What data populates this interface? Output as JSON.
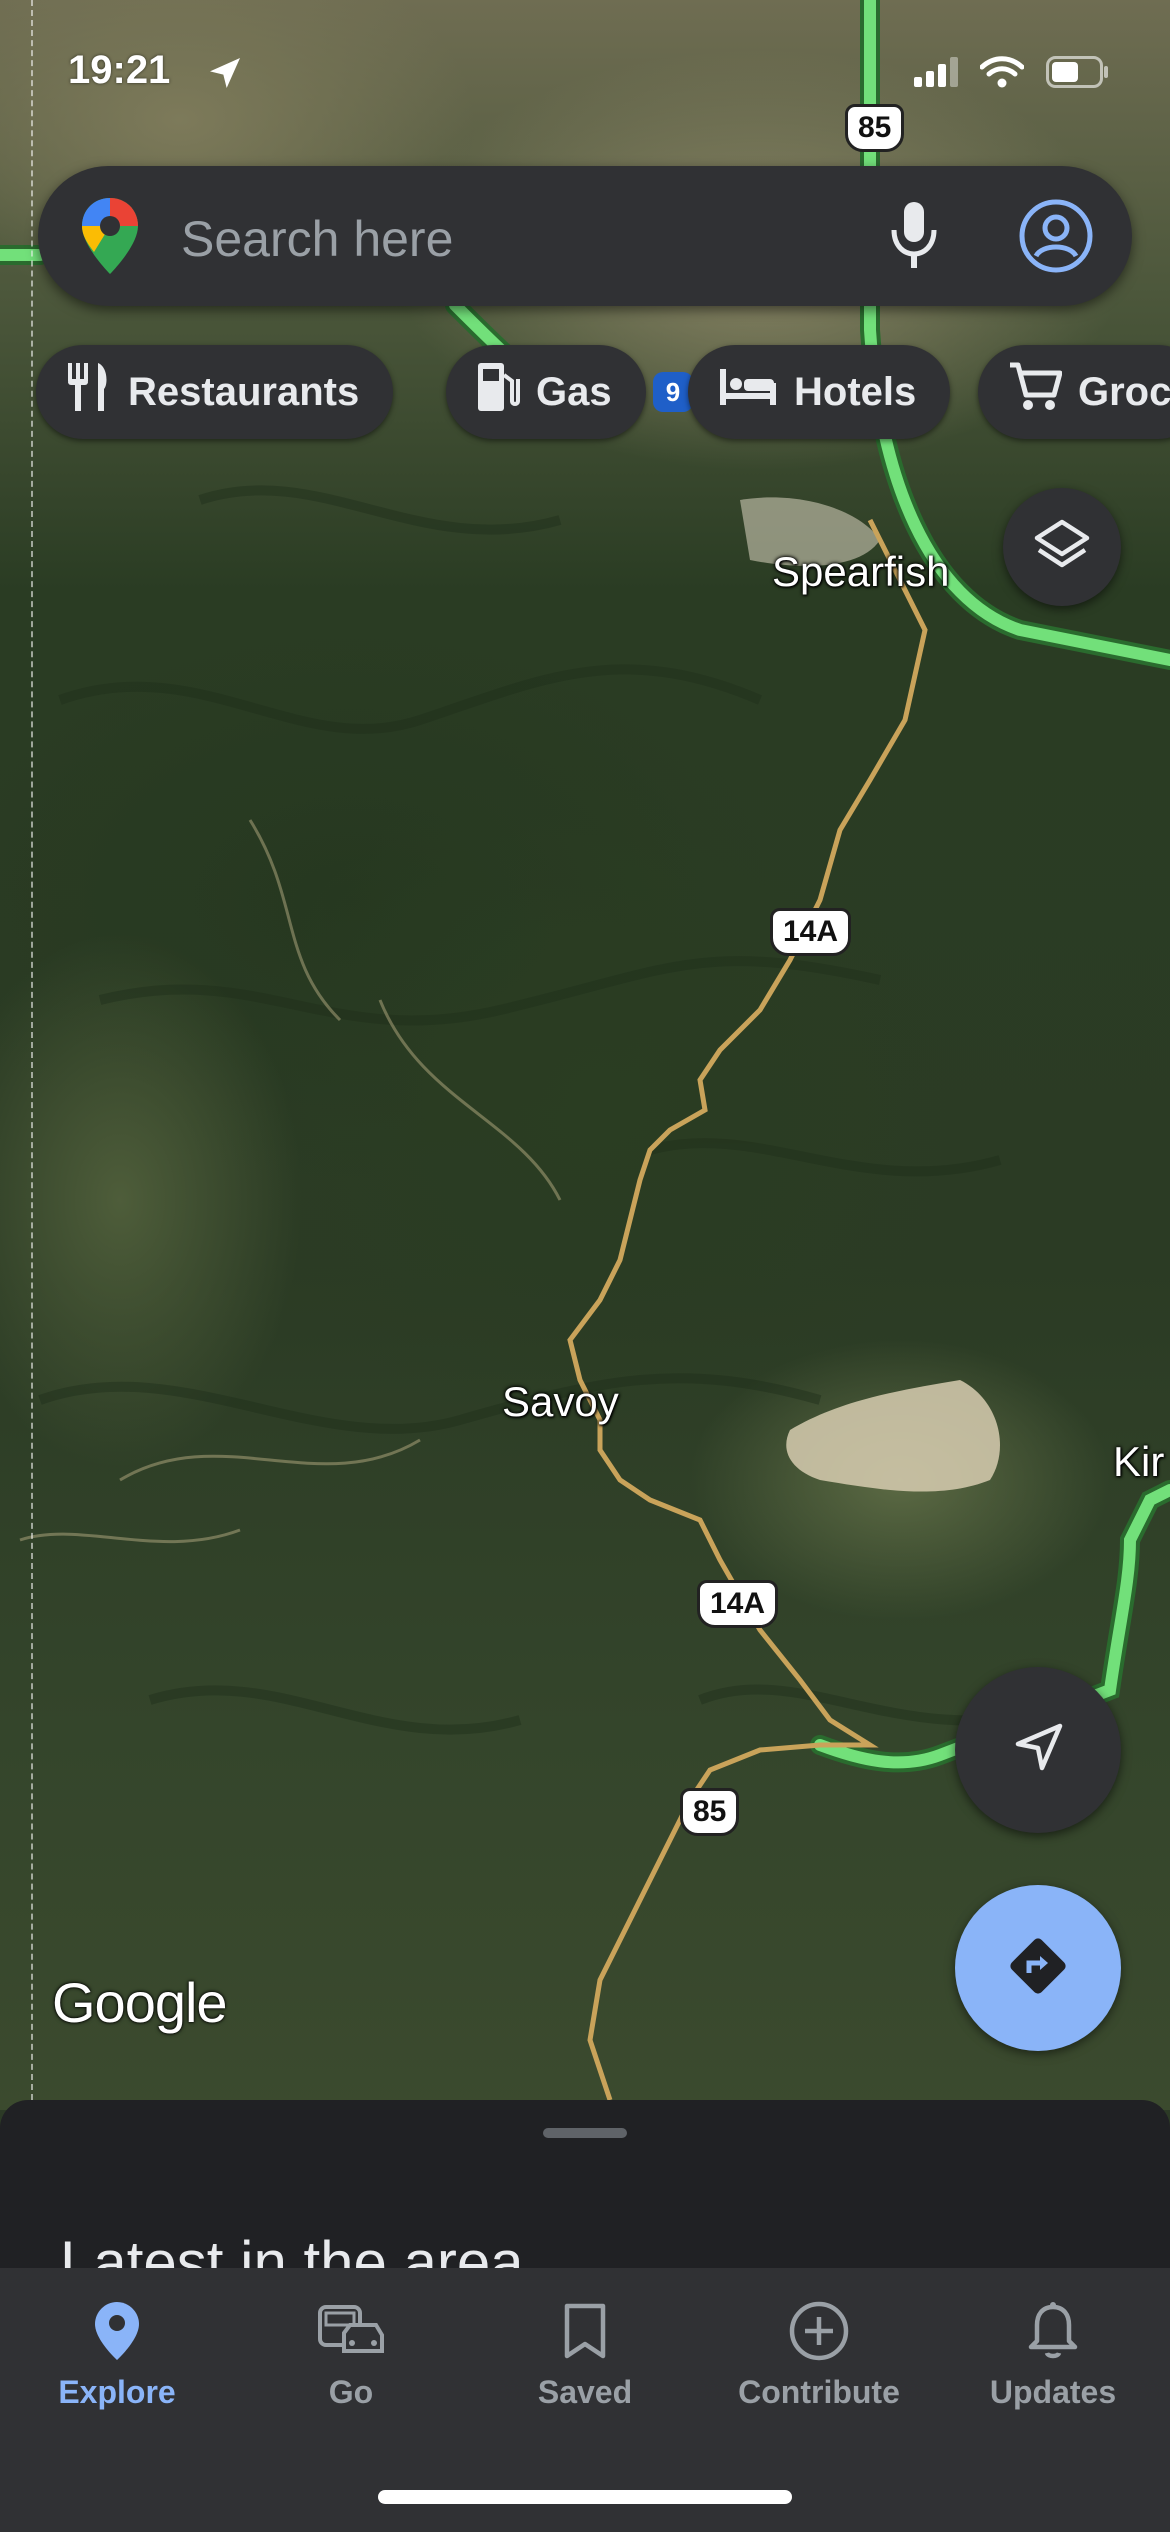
{
  "status_bar": {
    "time": "19:21",
    "icons": [
      "location-arrow-icon",
      "signal-icon",
      "wifi-icon",
      "battery-icon"
    ]
  },
  "search": {
    "placeholder": "Search here",
    "icons": [
      "maps-pin-icon",
      "microphone-icon",
      "account-icon"
    ]
  },
  "chips": [
    {
      "label": "Restaurants",
      "icon": "restaurant-icon"
    },
    {
      "label": "Gas",
      "icon": "gas-station-icon"
    },
    {
      "label": "Hotels",
      "icon": "hotel-bed-icon"
    },
    {
      "label": "Groc",
      "icon": "shopping-cart-icon"
    }
  ],
  "map": {
    "places": [
      "Spearfish",
      "Savoy",
      "Kir"
    ],
    "route_shields": [
      "85",
      "14A",
      "14A",
      "85"
    ],
    "interstate_partial": "9",
    "attribution": "Google",
    "colors": {
      "highway": "#6fdc6b",
      "road": "#c9a35a"
    }
  },
  "map_buttons": [
    "layers-icon",
    "my-location-icon",
    "directions-icon"
  ],
  "sheet": {
    "title": "Latest in the area"
  },
  "bottom_nav": [
    {
      "label": "Explore",
      "icon": "explore-pin-icon",
      "active": true
    },
    {
      "label": "Go",
      "icon": "go-commute-icon",
      "active": false
    },
    {
      "label": "Saved",
      "icon": "saved-bookmark-icon",
      "active": false
    },
    {
      "label": "Contribute",
      "icon": "contribute-plus-icon",
      "active": false
    },
    {
      "label": "Updates",
      "icon": "updates-bell-icon",
      "active": false
    }
  ],
  "colors": {
    "accent": "#8ab4f8",
    "surface": "#303134",
    "sheet": "#202124"
  }
}
